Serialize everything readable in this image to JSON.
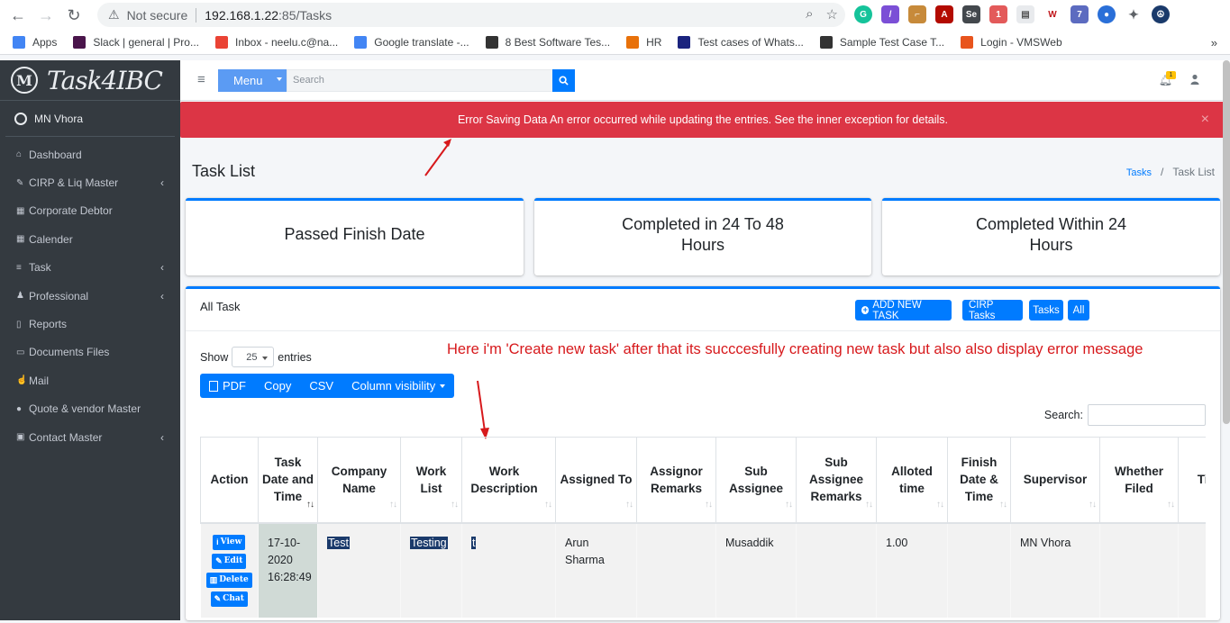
{
  "browser": {
    "security_label": "Not secure",
    "url_host": "192.168.1.22",
    "url_path": ":85/Tasks",
    "bookmarks": [
      {
        "label": "Apps",
        "color": "#4285f4"
      },
      {
        "label": "Slack | general | Pro...",
        "color": "#4a154b"
      },
      {
        "label": "Inbox - neelu.c@na...",
        "color": "#ea4335"
      },
      {
        "label": "Google translate -...",
        "color": "#4285f4"
      },
      {
        "label": "8 Best Software Tes...",
        "color": "#333333"
      },
      {
        "label": "HR",
        "color": "#e8710a"
      },
      {
        "label": "Test cases of Whats...",
        "color": "#1a237e"
      },
      {
        "label": "Sample Test Case T...",
        "color": "#333333"
      },
      {
        "label": "Login - VMSWeb",
        "color": "#e8541d"
      }
    ],
    "more_bookmarks": "»"
  },
  "sidebar": {
    "brand": "Task4IBC",
    "brand_logo": "M",
    "user": "MN Vhora",
    "items": [
      {
        "label": "Dashboard",
        "icon": "home-icon",
        "has_children": false
      },
      {
        "label": "CIRP & Liq Master",
        "icon": "pencil-icon",
        "has_children": true
      },
      {
        "label": "Corporate Debtor",
        "icon": "building-icon",
        "has_children": false
      },
      {
        "label": "Calender",
        "icon": "calendar-icon",
        "has_children": false
      },
      {
        "label": "Task",
        "icon": "list-icon",
        "has_children": true
      },
      {
        "label": "Professional",
        "icon": "users-icon",
        "has_children": true
      },
      {
        "label": "Reports",
        "icon": "file-icon",
        "has_children": false
      },
      {
        "label": "Documents Files",
        "icon": "folder-icon",
        "has_children": false
      },
      {
        "label": "Mail",
        "icon": "thumbs-up-icon",
        "has_children": false
      },
      {
        "label": "Quote & vendor Master",
        "icon": "info-icon",
        "has_children": false
      },
      {
        "label": "Contact Master",
        "icon": "contact-icon",
        "has_children": true
      }
    ]
  },
  "topbar": {
    "menu_label": "Menu",
    "search_placeholder": "Search",
    "notification_count": "1"
  },
  "alert": {
    "message": "Error Saving Data An error occurred while updating the entries. See the inner exception for details.",
    "close": "×"
  },
  "page": {
    "title": "Task List",
    "breadcrumb_link": "Tasks",
    "breadcrumb_current": "Task List"
  },
  "cards": [
    {
      "label": "Passed Finish Date"
    },
    {
      "label": "Completed in 24 To 48 Hours"
    },
    {
      "label": "Completed Within 24 Hours"
    }
  ],
  "panel": {
    "title": "All Task",
    "add_button": "ADD NEW TASK",
    "filter_buttons": [
      "CIRP Tasks",
      "Tasks",
      "All"
    ],
    "show_label": "Show",
    "entries_value": "25",
    "entries_label": "entries",
    "search_label": "Search:",
    "export_buttons": [
      "PDF",
      "Copy",
      "CSV",
      "Column visibility"
    ]
  },
  "annotation": "Here i'm 'Create new task' after that its succcesfully creating new task but also also display error message",
  "table": {
    "columns": [
      "Action",
      "Task Date and Time",
      "Company Name",
      "Work List",
      "Work Description",
      "Assigned To",
      "Assignor Remarks",
      "Sub Assignee",
      "Sub Assignee Remarks",
      "Alloted time",
      "Finish Date & Time",
      "Supervisor",
      "Whether Filed",
      "Time Spent"
    ],
    "row": {
      "actions": [
        "View",
        "Edit",
        "Delete",
        "Chat"
      ],
      "task_date": "17-10-2020 16:28:49",
      "company": "Test",
      "work_list": "Testing",
      "work_description": "t",
      "assigned_to": "Arun Sharma",
      "assignor_remarks": "",
      "sub_assignee": "Musaddik",
      "sub_assignee_remarks": "",
      "alloted_time": "1.00",
      "finish_date": "",
      "supervisor": "MN Vhora",
      "whether_filed": "",
      "time_spent": ""
    }
  }
}
